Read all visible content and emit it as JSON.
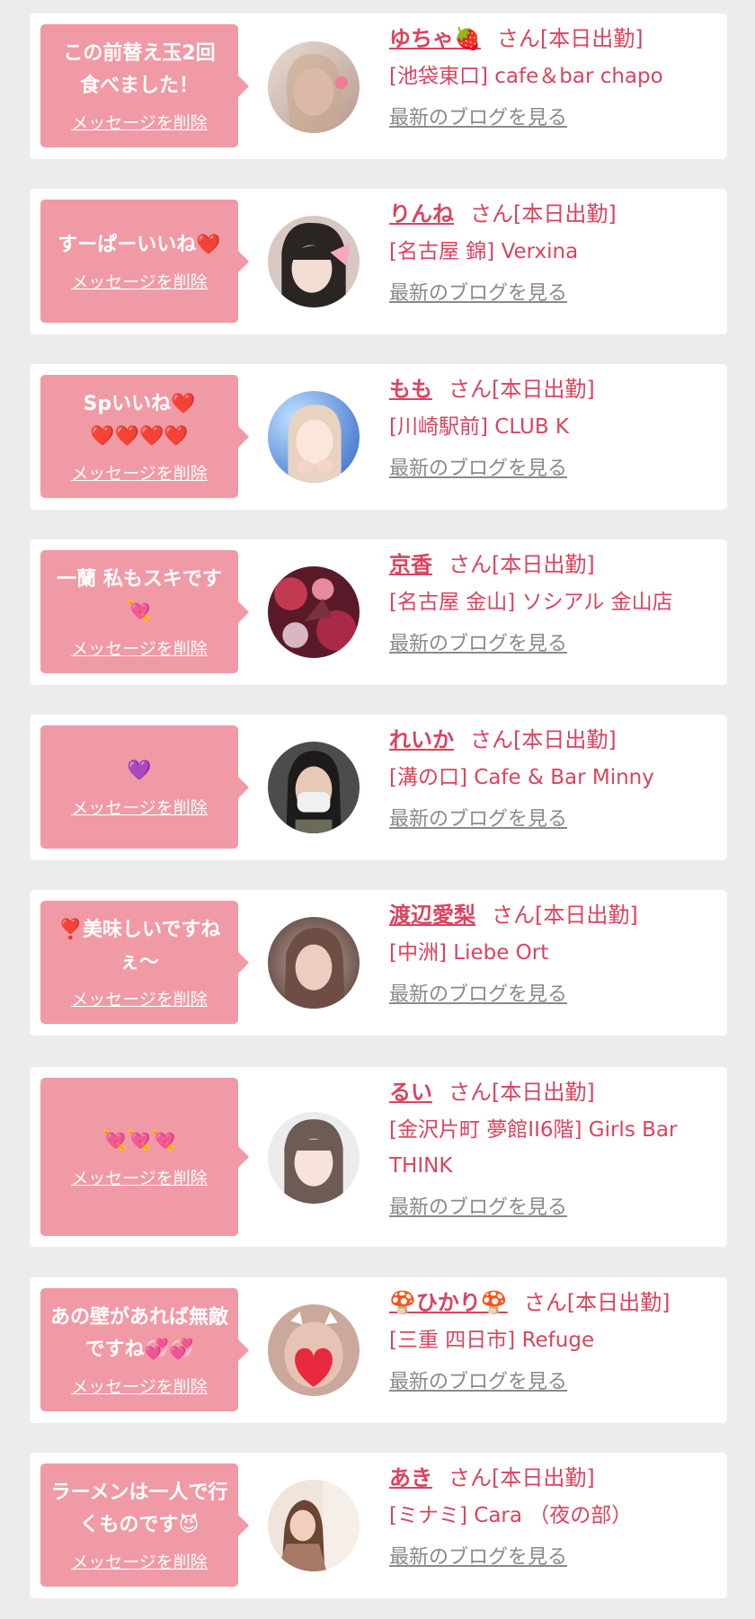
{
  "delete_label": "メッセージを削除",
  "blog_label": "最新のブログを見る",
  "status_suffix": "さん[本日出勤]",
  "colors": {
    "page_bg": "#ececec",
    "card_bg": "#ffffff",
    "bubble": "#f09aa6",
    "name": "#d9445e",
    "link_gray": "#8a8a8a"
  },
  "items": [
    {
      "message": "この前替え玉2回食べました！",
      "name": "ゆちゃ🍓",
      "shop": "[池袋東口] cafe＆bar chapo",
      "avatar_icon": "avatar-photo"
    },
    {
      "message": "すーぱーいいね❤️",
      "name": "りんね",
      "shop": "[名古屋 錦] Verxina",
      "avatar_icon": "avatar-photo"
    },
    {
      "message": "Spいいね❤️❤️❤️❤️❤️",
      "name": "もも",
      "shop": "[川崎駅前] CLUB K",
      "avatar_icon": "avatar-photo"
    },
    {
      "message": "一蘭 私もスキです💘",
      "name": "京香",
      "shop": "[名古屋 金山] ソシアル 金山店",
      "avatar_icon": "avatar-photo"
    },
    {
      "message": "💜",
      "name": "れいか",
      "shop": "[溝の口] Cafe & Bar Minny",
      "avatar_icon": "avatar-photo"
    },
    {
      "message": "❣️美味しいですねぇ〜",
      "name": "渡辺愛梨",
      "shop": "[中洲] Liebe Ort",
      "avatar_icon": "avatar-photo"
    },
    {
      "message": "💘💘💘",
      "name": "るい",
      "shop": "[金沢片町 夢館II6階] Girls Bar THINK",
      "avatar_icon": "avatar-photo"
    },
    {
      "message": "あの壁があれば無敵ですね💞💞",
      "name": "🍄ひかり🍄",
      "shop": "[三重 四日市] Refuge",
      "avatar_icon": "avatar-photo"
    },
    {
      "message": "ラーメンは一人で行くものです😈",
      "name": "あき",
      "shop": "[ミナミ] Cara （夜の部）",
      "avatar_icon": "avatar-photo"
    }
  ]
}
